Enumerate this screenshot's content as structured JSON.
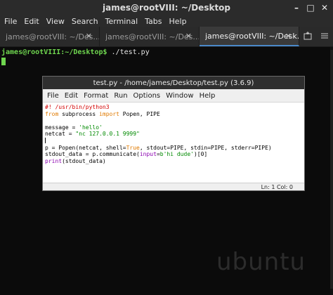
{
  "window": {
    "title": "james@rootVIII: ~/Desktop",
    "controls": [
      "–",
      "□",
      "✕"
    ]
  },
  "menubar": [
    "File",
    "Edit",
    "View",
    "Search",
    "Terminal",
    "Tabs",
    "Help"
  ],
  "tabs": [
    {
      "label": "james@rootVIII: ~/Des...",
      "close": "✕"
    },
    {
      "label": "james@rootVIII: ~/Des...",
      "close": "✕"
    },
    {
      "label": "james@rootVIII: ~/Desk...",
      "close": "✕",
      "active": true
    }
  ],
  "tab_tools": {
    "new_tab_icon": "new-tab-icon",
    "menu_icon": "menu-icon"
  },
  "terminal": {
    "prompt": "james@rootVIII:~/Desktop$",
    "command": " ./test.py",
    "wallpaper_text": "ubuntu"
  },
  "idle": {
    "title": "test.py - /home/james/Desktop/test.py (3.6.9)",
    "menu": [
      "File",
      "Edit",
      "Format",
      "Run",
      "Options",
      "Window",
      "Help"
    ],
    "code": [
      "#! /usr/bin/python3",
      "from subprocess import Popen, PIPE",
      "",
      "message = 'hello'",
      "netcat = \"nc 127.0.0.1 9999\"",
      "",
      "p = Popen(netcat, shell=True, stdout=PIPE, stdin=PIPE, stderr=PIPE)",
      "stdout_data = p.communicate(input=b'hi dude')[0]",
      "print(stdout_data)"
    ],
    "status": "Ln: 1  Col: 0"
  },
  "colors": {
    "prompt_green": "#6fd64f",
    "accent_blue": "#4b89c9"
  }
}
